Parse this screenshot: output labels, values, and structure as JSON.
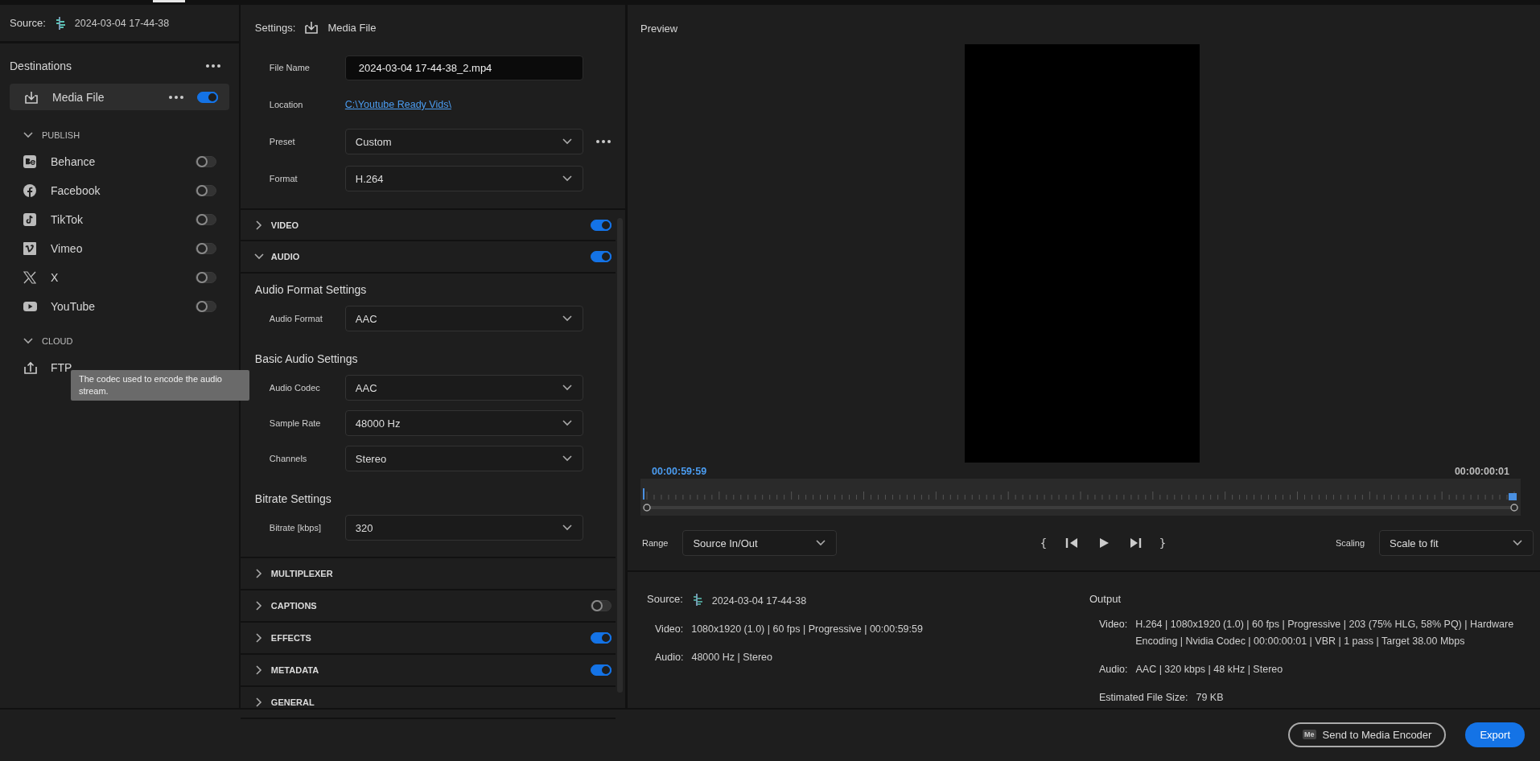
{
  "source": {
    "label": "Source:",
    "name": "2024-03-04 17-44-38"
  },
  "destinations": {
    "title": "Destinations",
    "media_file": {
      "label": "Media File",
      "on": true
    },
    "groups": [
      {
        "title": "PUBLISH",
        "expanded": true,
        "items": [
          {
            "label": "Behance",
            "on": false
          },
          {
            "label": "Facebook",
            "on": false
          },
          {
            "label": "TikTok",
            "on": false
          },
          {
            "label": "Vimeo",
            "on": false
          },
          {
            "label": "X",
            "on": false
          },
          {
            "label": "YouTube",
            "on": false
          }
        ]
      },
      {
        "title": "CLOUD",
        "expanded": true,
        "items": [
          {
            "label": "FTP"
          }
        ]
      }
    ]
  },
  "tooltip": {
    "text": "The codec used to encode the audio stream."
  },
  "settings": {
    "label": "Settings:",
    "destination": "Media File",
    "fields": [
      {
        "label": "File Name",
        "kind": "text",
        "value": "2024-03-04 17-44-38_2.mp4"
      },
      {
        "label": "Location",
        "kind": "link",
        "value": "C:\\Youtube Ready Vids\\"
      },
      {
        "label": "Preset",
        "kind": "dropdown",
        "value": "Custom",
        "more": true
      },
      {
        "label": "Format",
        "kind": "dropdown",
        "value": "H.264"
      }
    ],
    "sections": [
      {
        "title": "VIDEO",
        "expanded": false,
        "on": true
      },
      {
        "title": "AUDIO",
        "expanded": true,
        "on": true,
        "groups": [
          {
            "title": "Audio Format Settings",
            "fields": [
              {
                "label": "Audio Format",
                "value": "AAC"
              }
            ]
          },
          {
            "title": "Basic Audio Settings",
            "fields": [
              {
                "label": "Audio Codec",
                "value": "AAC"
              },
              {
                "label": "Sample Rate",
                "value": "48000 Hz"
              },
              {
                "label": "Channels",
                "value": "Stereo"
              }
            ]
          },
          {
            "title": "Bitrate Settings",
            "fields": [
              {
                "label": "Bitrate [kbps]",
                "value": "320"
              }
            ]
          }
        ]
      },
      {
        "title": "MULTIPLEXER",
        "expanded": false
      },
      {
        "title": "CAPTIONS",
        "expanded": false,
        "on": false
      },
      {
        "title": "EFFECTS",
        "expanded": false,
        "on": true
      },
      {
        "title": "METADATA",
        "expanded": false,
        "on": true
      },
      {
        "title": "GENERAL",
        "expanded": false
      }
    ]
  },
  "preview": {
    "title": "Preview",
    "timecode_in": "00:00:59:59",
    "timecode_out": "00:00:00:01",
    "range": {
      "label": "Range",
      "value": "Source In/Out"
    },
    "transport": [
      {
        "kind": "glyph",
        "text": "{"
      },
      {
        "kind": "step-back"
      },
      {
        "kind": "play"
      },
      {
        "kind": "step-forward"
      },
      {
        "kind": "glyph",
        "text": "}"
      }
    ],
    "scaling": {
      "label": "Scaling",
      "value": "Scale to fit"
    }
  },
  "summary": {
    "source": {
      "label": "Source:",
      "name": "2024-03-04 17-44-38",
      "rows": [
        {
          "label": "Video:",
          "value": "1080x1920 (1.0) | 60 fps | Progressive | 00:00:59:59"
        },
        {
          "label": "Audio:",
          "value": "48000 Hz | Stereo"
        }
      ]
    },
    "output": {
      "title": "Output",
      "rows": [
        {
          "label": "Video:",
          "value": "H.264 | 1080x1920 (1.0) | 60 fps | Progressive | 203 (75% HLG, 58% PQ) | Hardware Encoding | Nvidia Codec | 00:00:00:01  | VBR | 1 pass | Target 38.00 Mbps"
        },
        {
          "label": "Audio:",
          "value": "AAC | 320 kbps | 48 kHz | Stereo"
        },
        {
          "label": "Estimated File Size:",
          "value": "79 KB"
        }
      ]
    }
  },
  "footer": {
    "buttons": [
      {
        "kind": "secondary",
        "badge": "Me",
        "label": "Send to Media Encoder"
      },
      {
        "kind": "primary",
        "label": "Export"
      }
    ]
  }
}
